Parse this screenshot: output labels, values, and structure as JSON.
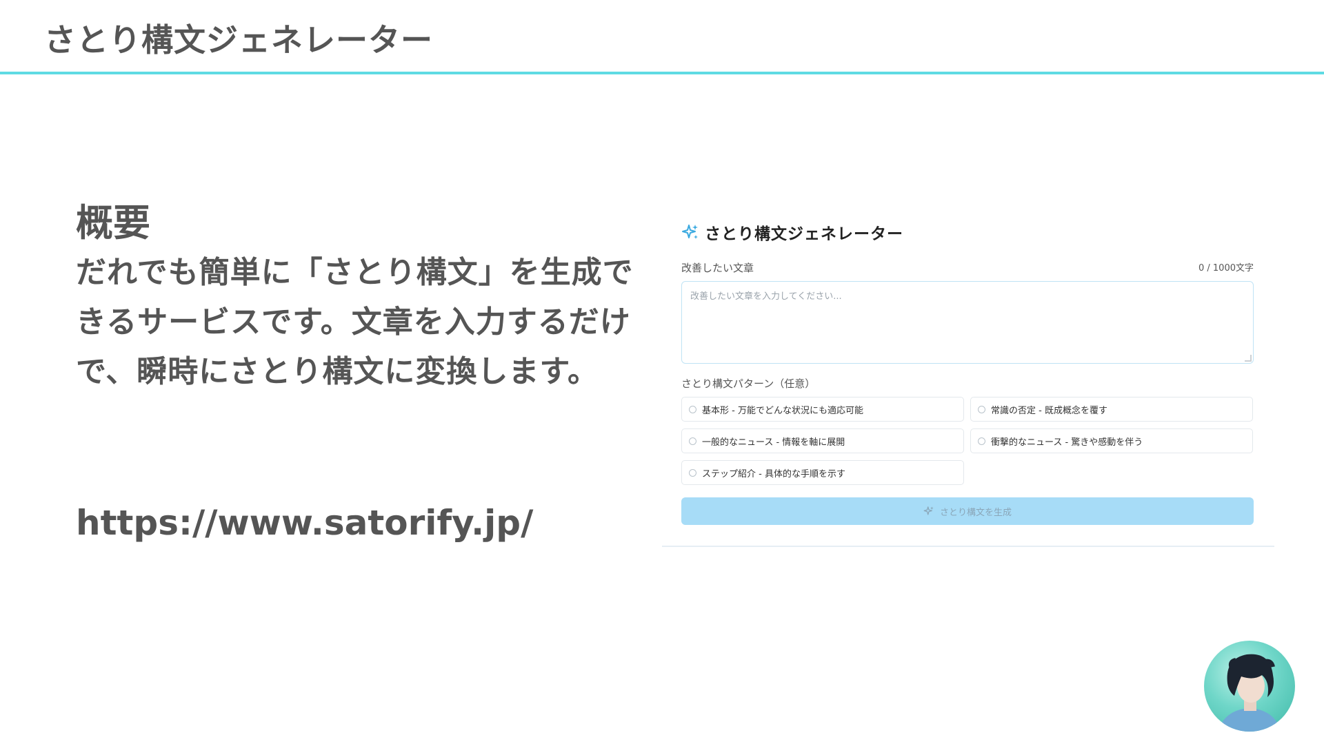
{
  "slide": {
    "title": "さとり構文ジェネレーター",
    "accent_color": "#5fdbe3"
  },
  "overview": {
    "heading": "概要",
    "body": "だれでも簡単に「さとり構文」を生成できるサービスです。文章を入力するだけで、瞬時にさとり構文に変換します。",
    "url": "https://www.satorify.jp/"
  },
  "app": {
    "title": "さとり構文ジェネレーター",
    "title_icon": "sparkle-icon",
    "input_label": "改善したい文章",
    "char_count": "0 / 1000文字",
    "input_placeholder": "改善したい文章を入力してください...",
    "input_value": "",
    "pattern_label": "さとり構文パターン（任意）",
    "patterns": [
      {
        "label": "基本形 - 万能でどんな状況にも適応可能",
        "selected": false
      },
      {
        "label": "常識の否定 - 既成概念を覆す",
        "selected": false
      },
      {
        "label": "一般的なニュース - 情報を軸に展開",
        "selected": false
      },
      {
        "label": "衝撃的なニュース - 驚きや感動を伴う",
        "selected": false
      },
      {
        "label": "ステップ紹介 - 具体的な手順を示す",
        "selected": false
      }
    ],
    "generate_button": "さとり構文を生成",
    "button_color": "#a7dcf7",
    "icon_color": "#3aa9e0"
  },
  "avatar": {
    "icon": "avatar"
  }
}
